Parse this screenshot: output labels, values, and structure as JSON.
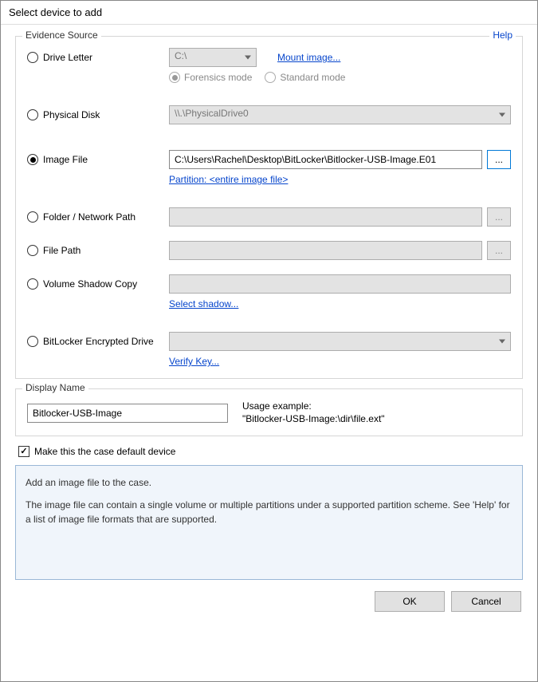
{
  "window": {
    "title": "Select device to add"
  },
  "evidence": {
    "group_label": "Evidence Source",
    "help_label": "Help",
    "drive_letter": {
      "label": "Drive Letter",
      "selected_value": "C:\\",
      "mount_link": "Mount image...",
      "forensics_label": "Forensics mode",
      "standard_label": "Standard mode"
    },
    "physical_disk": {
      "label": "Physical Disk",
      "selected_value": "\\\\.\\PhysicalDrive0"
    },
    "image_file": {
      "label": "Image File",
      "value": "C:\\Users\\Rachel\\Desktop\\BitLocker\\Bitlocker-USB-Image.E01",
      "browse_label": "...",
      "partition_link": "Partition: <entire image file>"
    },
    "folder_path": {
      "label": "Folder / Network Path",
      "value": "",
      "browse_label": "..."
    },
    "file_path": {
      "label": "File Path",
      "value": "",
      "browse_label": "..."
    },
    "shadow_copy": {
      "label": "Volume Shadow Copy",
      "value": "",
      "select_link": "Select shadow..."
    },
    "bitlocker": {
      "label": "BitLocker Encrypted Drive",
      "selected_value": "",
      "verify_link": "Verify Key..."
    }
  },
  "display_name": {
    "group_label": "Display Name",
    "value": "Bitlocker-USB-Image",
    "usage_label": "Usage example:",
    "usage_example": "\"Bitlocker-USB-Image:\\dir\\file.ext\""
  },
  "default_device_check": "Make this the case default device",
  "info": {
    "line1": "Add an image file to the case.",
    "line2": "The image file can contain a single volume or multiple partitions under a supported partition scheme. See 'Help' for a list of image file formats that are supported."
  },
  "buttons": {
    "ok": "OK",
    "cancel": "Cancel"
  }
}
